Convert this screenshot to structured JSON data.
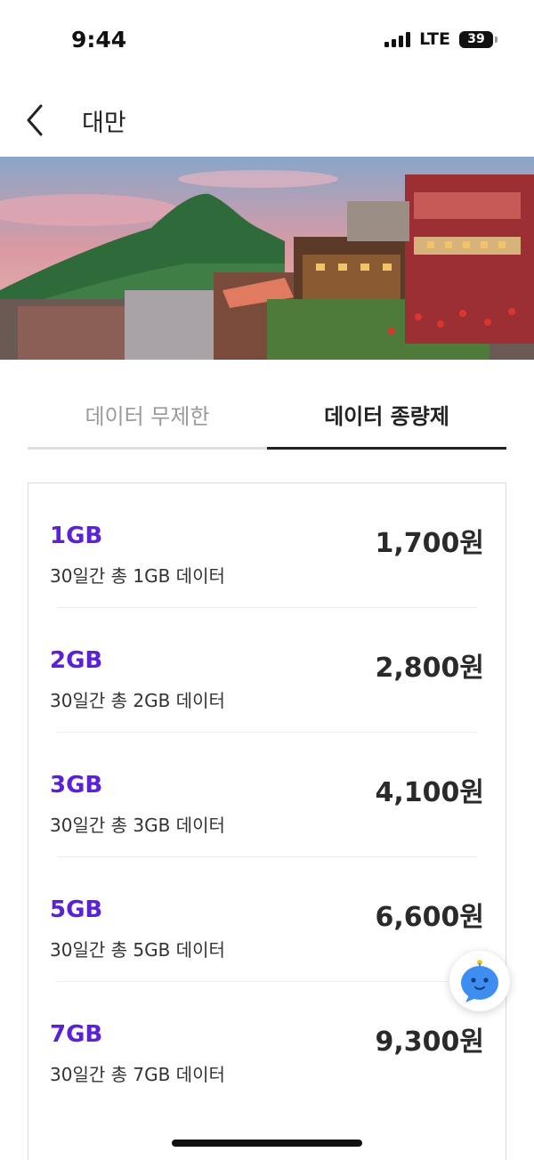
{
  "status": {
    "time": "9:44",
    "network": "LTE",
    "battery": "39"
  },
  "header": {
    "title": "대만"
  },
  "tabs": [
    {
      "label": "데이터 무제한"
    },
    {
      "label": "데이터 종량제"
    }
  ],
  "active_tab": "데이터 종량제",
  "plans": [
    {
      "name": "1GB",
      "desc": "30일간 총 1GB 데이터",
      "price": "1,700원"
    },
    {
      "name": "2GB",
      "desc": "30일간 총 2GB 데이터",
      "price": "2,800원"
    },
    {
      "name": "3GB",
      "desc": "30일간 총 3GB 데이터",
      "price": "4,100원"
    },
    {
      "name": "5GB",
      "desc": "30일간 총 5GB 데이터",
      "price": "6,600원"
    },
    {
      "name": "7GB",
      "desc": "30일간 총 7GB 데이터",
      "price": "9,300원"
    }
  ],
  "colors": {
    "accent": "#5b21d6",
    "chatbot": "#3d8ef0"
  },
  "icons": {
    "back": "chevron-left-icon",
    "chatbot": "chatbot-icon"
  }
}
